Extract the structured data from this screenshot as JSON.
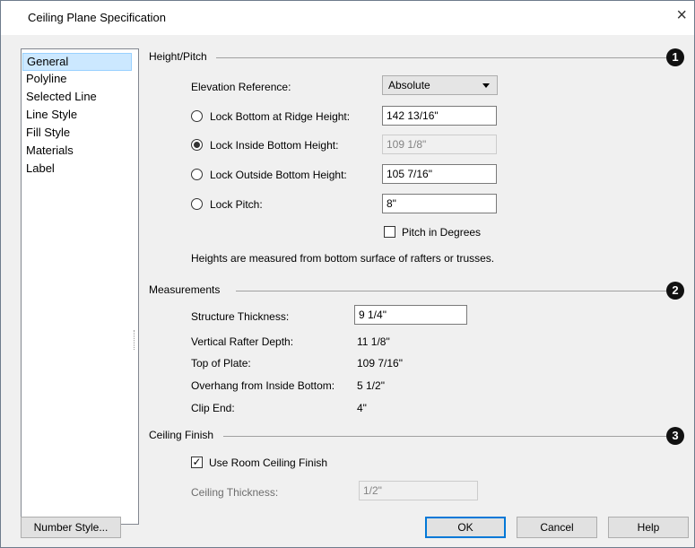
{
  "window": {
    "title": "Ceiling Plane Specification",
    "close_glyph": "×"
  },
  "sidebar": {
    "items": [
      {
        "label": "General",
        "selected": true
      },
      {
        "label": "Polyline"
      },
      {
        "label": "Selected Line"
      },
      {
        "label": "Line Style"
      },
      {
        "label": "Fill Style"
      },
      {
        "label": "Materials"
      },
      {
        "label": "Label"
      }
    ]
  },
  "height_pitch": {
    "group_title": "Height/Pitch",
    "badge": "1",
    "elevation_reference_label": "Elevation Reference:",
    "elevation_reference_value": "Absolute",
    "lock_bottom_ridge_label": "Lock Bottom at Ridge Height:",
    "lock_bottom_ridge_value": "142 13/16\"",
    "lock_inside_bottom_label": "Lock Inside Bottom Height:",
    "lock_inside_bottom_value": "109 1/8\"",
    "lock_outside_bottom_label": "Lock Outside Bottom Height:",
    "lock_outside_bottom_value": "105 7/16\"",
    "lock_pitch_label": "Lock Pitch:",
    "lock_pitch_value": "8\"",
    "pitch_in_degrees_label": "Pitch in Degrees",
    "pitch_in_degrees_checked": false,
    "selected_radio": "lock_inside_bottom",
    "note": "Heights are measured from bottom surface of rafters or trusses."
  },
  "measurements": {
    "group_title": "Measurements",
    "badge": "2",
    "structure_thickness_label": "Structure Thickness:",
    "structure_thickness_value": "9 1/4\"",
    "vertical_rafter_depth_label": "Vertical Rafter Depth:",
    "vertical_rafter_depth_value": "11 1/8\"",
    "top_of_plate_label": "Top of Plate:",
    "top_of_plate_value": "109 7/16\"",
    "overhang_label": "Overhang from Inside Bottom:",
    "overhang_value": "5 1/2\"",
    "clip_end_label": "Clip End:",
    "clip_end_value": "4\""
  },
  "ceiling_finish": {
    "group_title": "Ceiling Finish",
    "badge": "3",
    "use_room_finish_label": "Use Room Ceiling Finish",
    "use_room_finish_checked": true,
    "ceiling_thickness_label": "Ceiling Thickness:",
    "ceiling_thickness_value": "1/2\""
  },
  "footer": {
    "number_style_label": "Number Style...",
    "ok_label": "OK",
    "cancel_label": "Cancel",
    "help_label": "Help"
  }
}
